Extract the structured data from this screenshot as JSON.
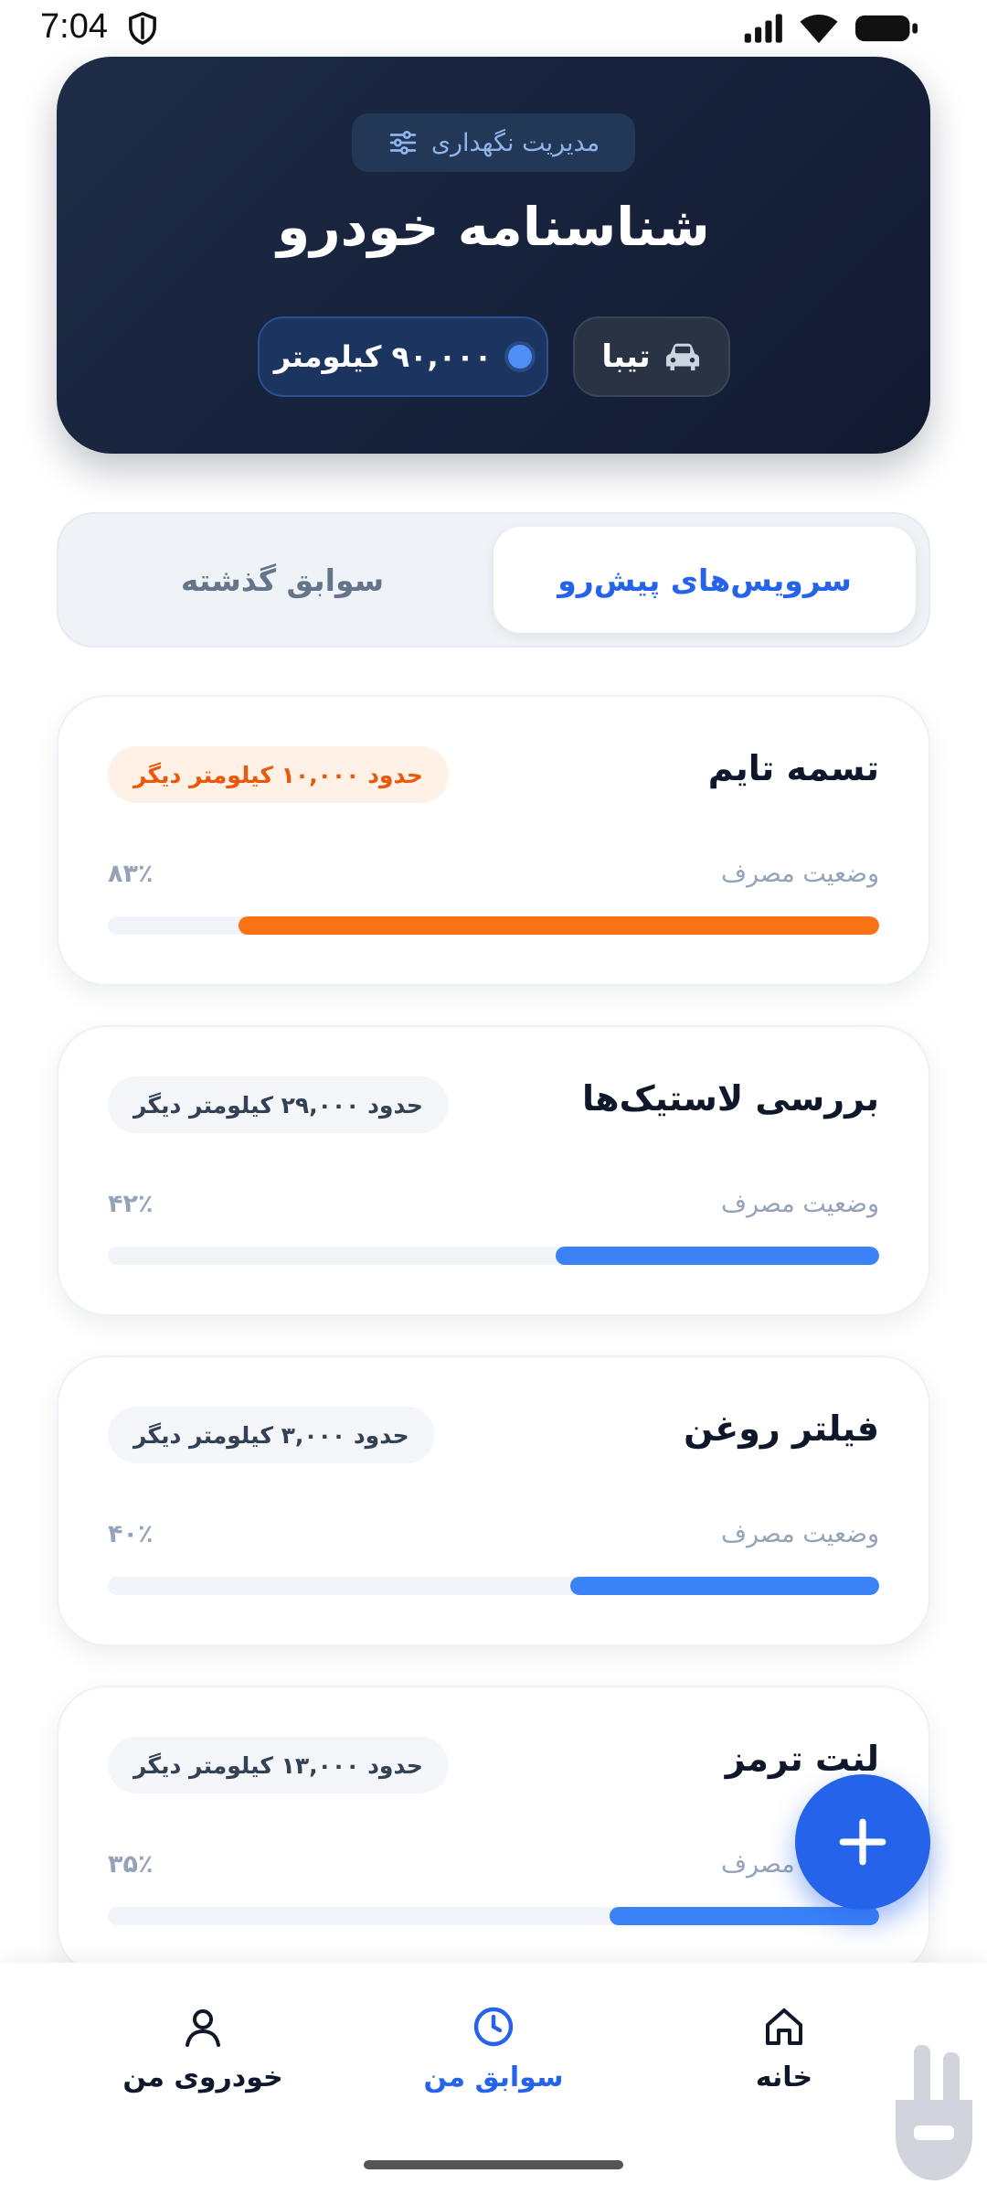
{
  "status_bar": {
    "time": "7:04"
  },
  "header": {
    "chip_label": "مدیریت نگهداری",
    "title": "شناسنامه خودرو",
    "car_name": "تیبا",
    "odometer": "۹۰,۰۰۰ کیلومتر"
  },
  "tabs": {
    "upcoming": "سرویس‌های پیش‌رو",
    "history": "سوابق گذشته"
  },
  "services": [
    {
      "title": "تسمه تایم",
      "remaining": "حدود ۱۰,۰۰۰ کیلومتر دیگر",
      "status_label": "وضعیت مصرف",
      "percent_label": "۸۳٪",
      "usage": 0.83,
      "color": "#f97316"
    },
    {
      "title": "بررسی لاستیک‌ها",
      "remaining": "حدود ۲۹,۰۰۰ کیلومتر دیگر",
      "status_label": "وضعیت مصرف",
      "percent_label": "۴۲٪",
      "usage": 0.42,
      "color": "#3b82f6"
    },
    {
      "title": "فیلتر روغن",
      "remaining": "حدود ۳,۰۰۰ کیلومتر دیگر",
      "status_label": "وضعیت مصرف",
      "percent_label": "۴۰٪",
      "usage": 0.4,
      "color": "#3b82f6"
    },
    {
      "title": "لنت ترمز",
      "remaining": "حدود ۱۳,۰۰۰ کیلومتر دیگر",
      "status_label": "وضعیت مصرف",
      "percent_label": "۳۵٪",
      "usage": 0.35,
      "color": "#3b82f6"
    }
  ],
  "fab": {
    "icon": "plus-icon"
  },
  "nav": {
    "home": "خانه",
    "records": "سوابق من",
    "my_car": "خودروی من"
  },
  "colors": {
    "accent": "#2563eb",
    "warning": "#f97316",
    "header_bg": "#18233d"
  }
}
